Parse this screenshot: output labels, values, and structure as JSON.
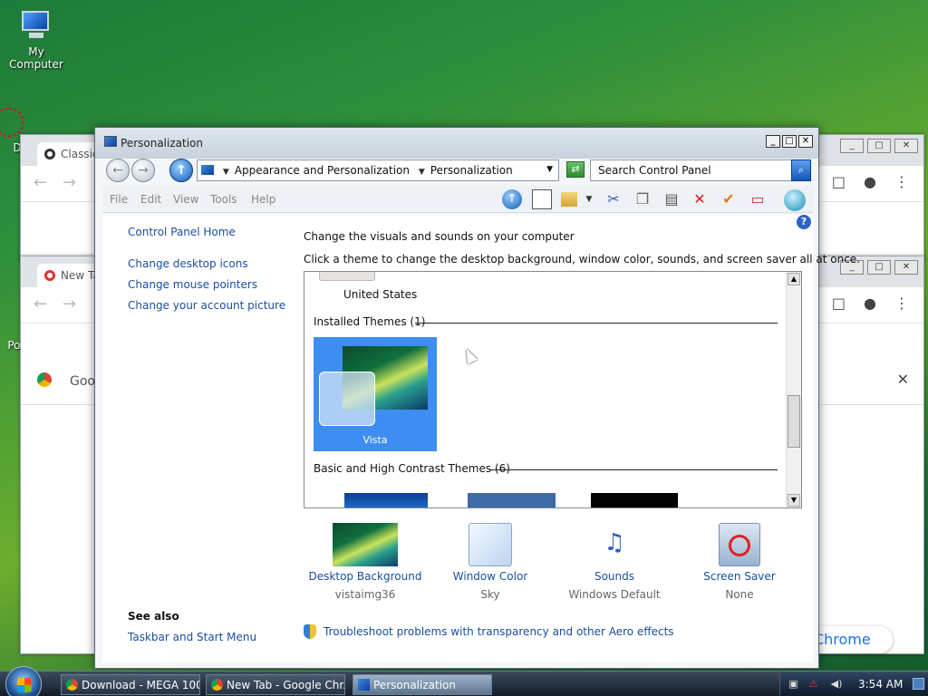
{
  "desktop": {
    "icons": [
      {
        "label": "My Computer",
        "icon": "monitor-icon"
      },
      {
        "label": "Dat",
        "icon": "network-icon"
      },
      {
        "label": "Pov",
        "icon": "power-icon"
      }
    ]
  },
  "bg_windows": {
    "chrome1_tab": "Classic",
    "chrome2_tab": "New Ta",
    "chrome2_omnibox": "Goog",
    "chrome_promo": "e Chrome",
    "glyphs": {
      "back": "←",
      "forward": "→",
      "refresh": "C",
      "close": "✕",
      "menu": "⋮",
      "square": "□"
    }
  },
  "window": {
    "title": "Personalization",
    "glyphs": {
      "minimize": "_",
      "maximize": "□",
      "close": "✕",
      "back": "←",
      "forward": "→",
      "up": "↑",
      "dropdown": "▼",
      "go": "⇄",
      "search": "⌕",
      "help": "?",
      "scroll_up": "▲",
      "scroll_down": "▼"
    },
    "breadcrumb": [
      "Appearance and Personalization",
      "Personalization"
    ],
    "search_placeholder": "Search Control Panel",
    "menu": [
      "File",
      "Edit",
      "View",
      "Tools",
      "Help"
    ],
    "toolbar_icons": [
      "up-arrow-icon",
      "panel-icon",
      "folder-icon",
      "scissors-icon",
      "copy-icon",
      "paste-icon",
      "delete-icon",
      "checkmark-icon",
      "rename-icon",
      "network-globe-icon"
    ],
    "left_links": [
      "Control Panel Home",
      "Change desktop icons",
      "Change mouse pointers",
      "Change your account picture"
    ],
    "heading": "Change the visuals and sounds on your computer",
    "subheading": "Click a theme to change the desktop background, window color, sounds, and screen saver all at once.",
    "theme_list": {
      "partial_item": "United States",
      "group1_title": "Installed Themes (1)",
      "selected_theme": "Vista",
      "group2_title": "Basic and High Contrast Themes (6)"
    },
    "bottom_items": [
      {
        "label": "Desktop Background",
        "value": "vistaimg36"
      },
      {
        "label": "Window Color",
        "value": "Sky"
      },
      {
        "label": "Sounds",
        "value": "Windows Default"
      },
      {
        "label": "Screen Saver",
        "value": "None"
      }
    ],
    "see_also_title": "See also",
    "see_also_link": "Taskbar and Start Menu",
    "troubleshoot_link": "Troubleshoot problems with transparency and other Aero effects"
  },
  "taskbar": {
    "items": [
      {
        "label": "Download - MEGA 100...",
        "active": false
      },
      {
        "label": "New Tab - Google Chr...",
        "active": false
      },
      {
        "label": "Personalization",
        "active": true
      }
    ],
    "clock": "3:54 AM",
    "tray_glyphs": {
      "network": "▣",
      "security": "⚠",
      "volume": "◀)"
    }
  }
}
